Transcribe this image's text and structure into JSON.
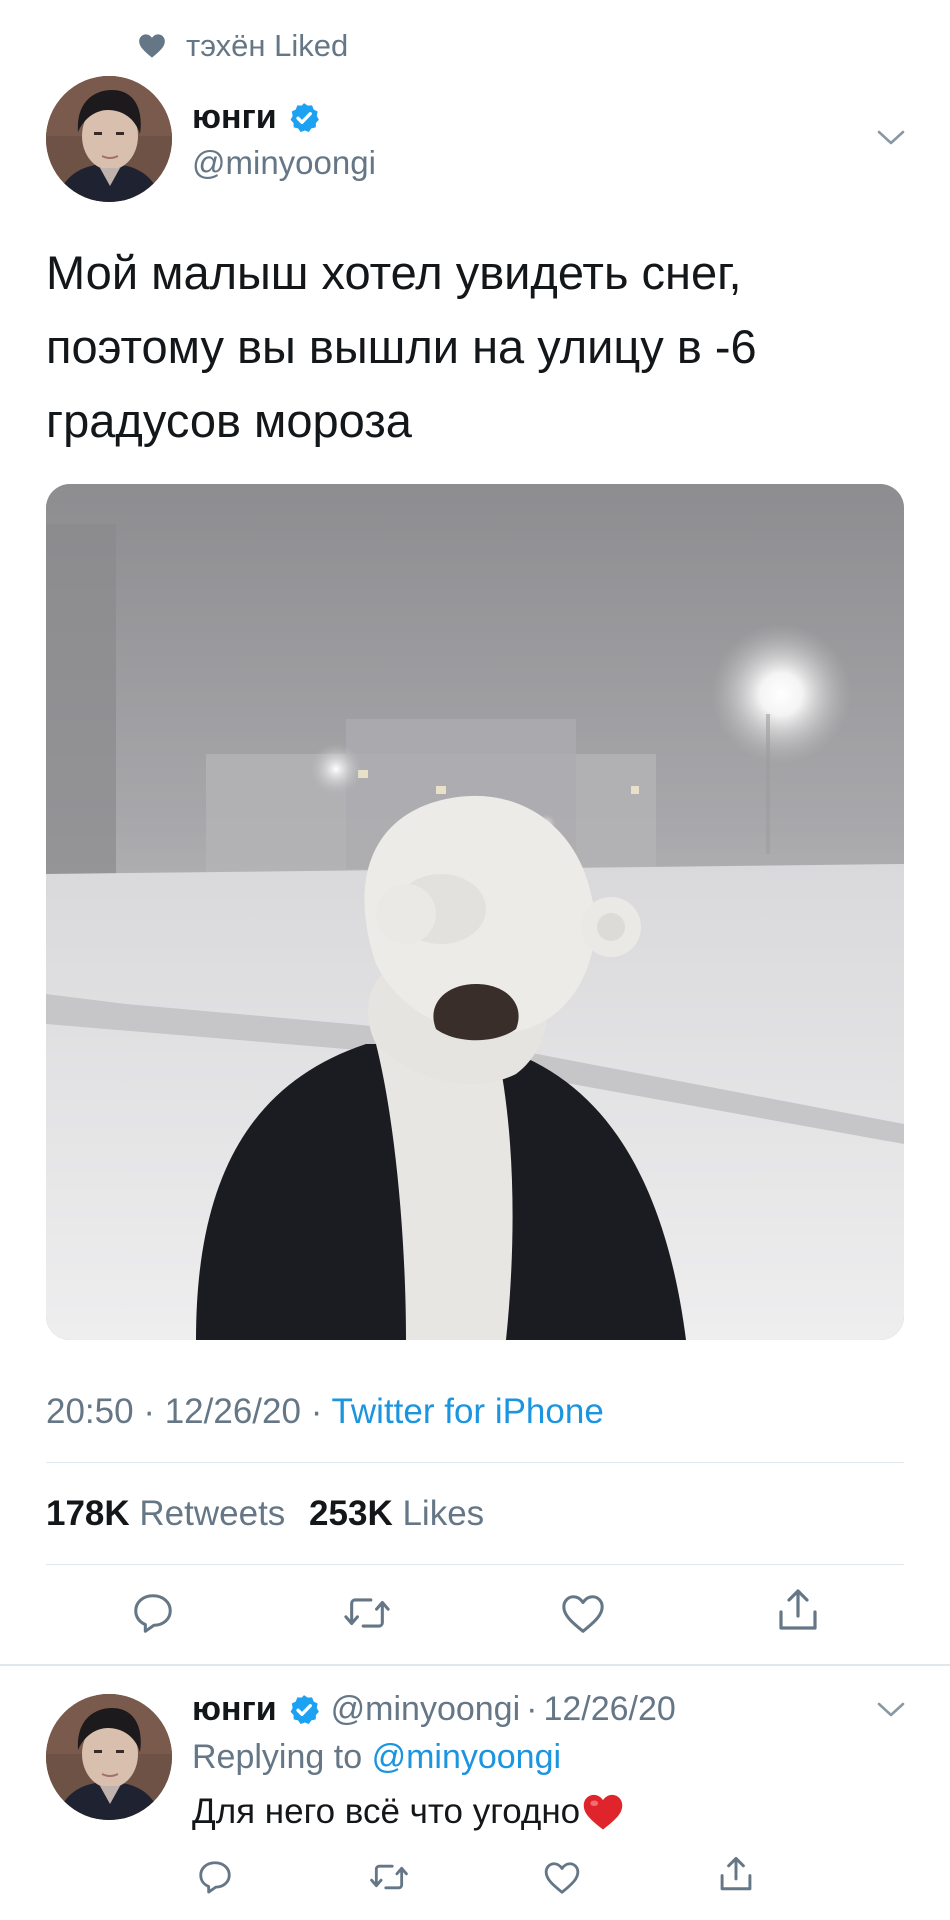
{
  "social_context": {
    "text": "тэхён Liked",
    "icon": "heart-icon"
  },
  "tweet": {
    "author_name": "юнги",
    "author_handle": "@minyoongi",
    "verified": true,
    "text": "Мой малыш хотел увидеть снег, поэтому вы вышли на улицу в -6 градусов мороза",
    "time": "20:50",
    "date": "12/26/20",
    "separator": "·",
    "source": "Twitter for iPhone",
    "retweets_count": "178K",
    "retweets_label": "Retweets",
    "likes_count": "253K",
    "likes_label": "Likes"
  },
  "reply": {
    "author_name": "юнги",
    "author_handle": "@minyoongi",
    "dot": "·",
    "date": "12/26/20",
    "replying_prefix": "Replying to",
    "replying_mention": "@minyoongi",
    "text": "Для него всё что угодно",
    "emoji": "red-heart-emoji"
  },
  "action_icons": [
    "reply-icon",
    "retweet-icon",
    "like-icon",
    "share-icon"
  ],
  "colors": {
    "text_primary": "#14171a",
    "text_secondary": "#657786",
    "link": "#1b95e0",
    "verified": "#1da1f2",
    "divider": "#e1e8ed"
  }
}
